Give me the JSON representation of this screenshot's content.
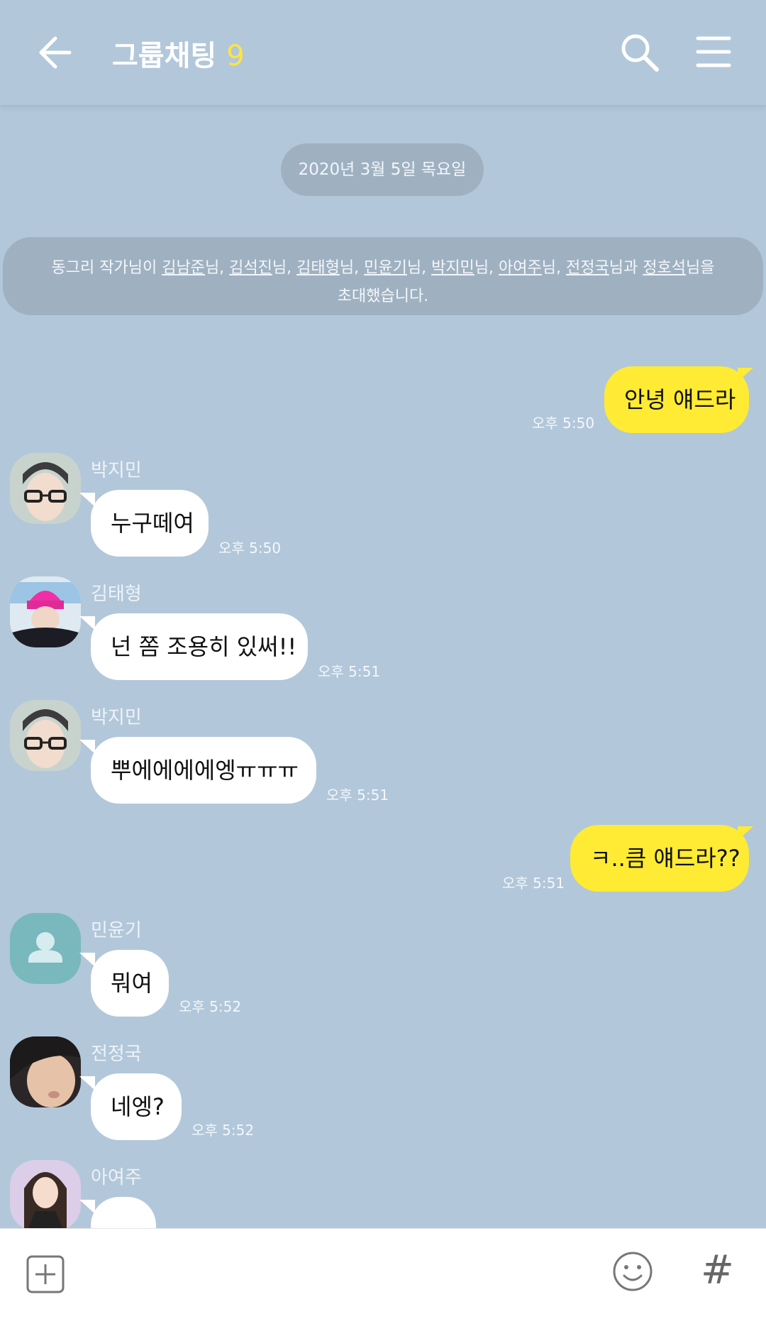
{
  "header": {
    "title": "그룹채팅",
    "member_count": "9"
  },
  "date_divider": "2020년 3월 5일 목요일",
  "notice": {
    "prefix": "동그리 작가님이 ",
    "names": [
      "김남준",
      "김석진",
      "김태형",
      "민윤기",
      "박지민",
      "아여주",
      "전정국",
      "정호석"
    ],
    "line1_tail": "님을",
    "line2": "초대했습니다."
  },
  "messages": [
    {
      "side": "out",
      "text": "안녕 얘드라",
      "time": "오후 5:50"
    },
    {
      "side": "in",
      "sender": "박지민",
      "text": "누구떼여",
      "time": "오후 5:50"
    },
    {
      "side": "in",
      "sender": "김태형",
      "text": "넌 쫌 조용히 있써!!",
      "time": "오후 5:51"
    },
    {
      "side": "in",
      "sender": "박지민",
      "text": "뿌에에에에엥ㅠㅠㅠ",
      "time": "오후 5:51"
    },
    {
      "side": "out",
      "text": "ㅋ..큼 얘드라??",
      "time": "오후 5:51"
    },
    {
      "side": "in",
      "sender": "민윤기",
      "text": "뭐여",
      "time": "오후 5:52"
    },
    {
      "side": "in",
      "sender": "전정국",
      "text": "네엥?",
      "time": "오후 5:52"
    },
    {
      "side": "in",
      "sender": "아여주",
      "text": "",
      "time": ""
    }
  ],
  "icons": {
    "back": "arrow-left-icon",
    "search": "search-icon",
    "menu": "hamburger-menu-icon",
    "plus": "plus-square-icon",
    "emoji": "smiley-icon",
    "hash": "hashtag-icon"
  },
  "hash_symbol": "#",
  "colors": {
    "background": "#b2c7da",
    "my_bubble": "#ffeb33",
    "their_bubble": "#ffffff",
    "count": "#ffe53f"
  }
}
